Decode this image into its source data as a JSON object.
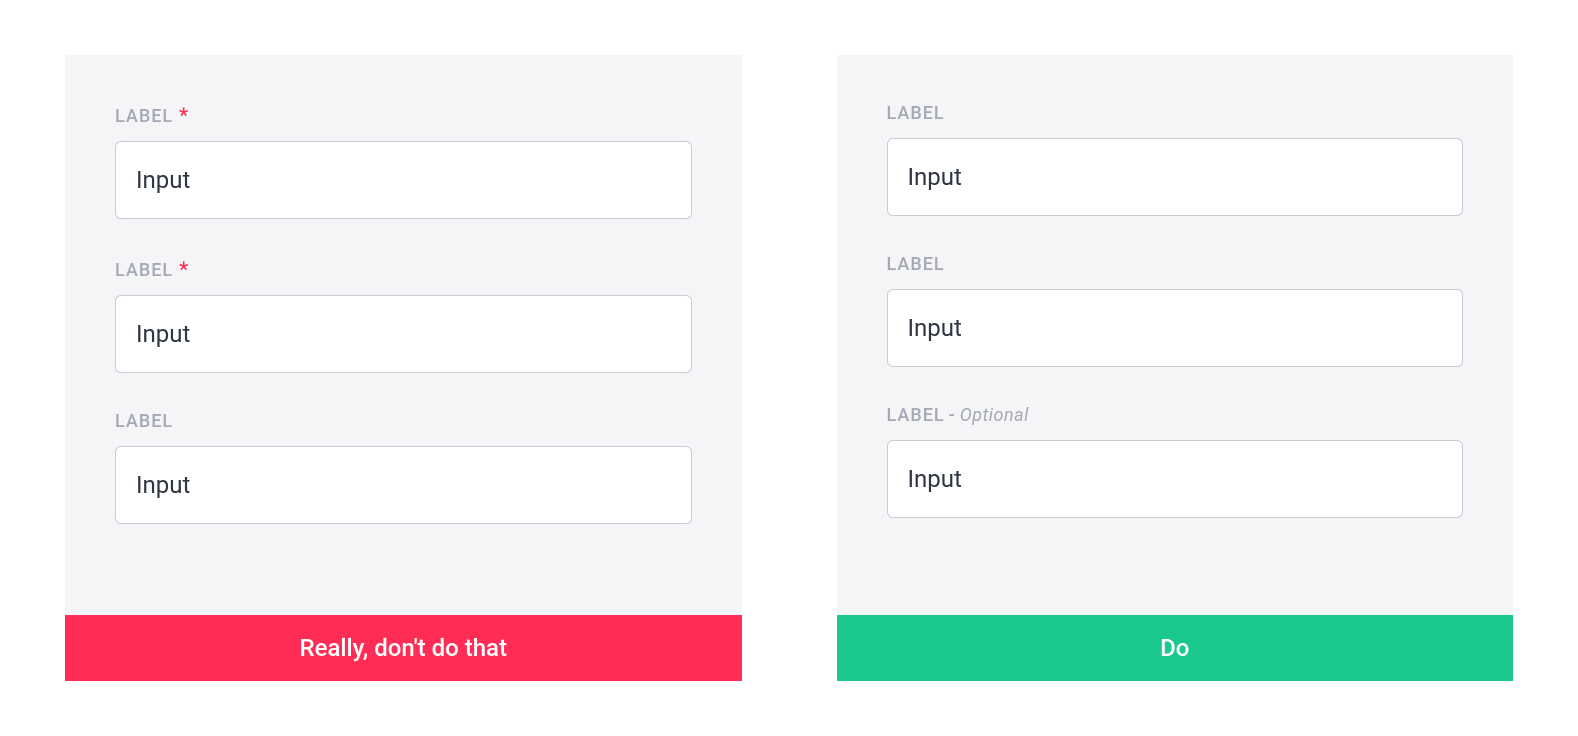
{
  "dont": {
    "fields": [
      {
        "label": "LABEL",
        "required": true,
        "value": "Input"
      },
      {
        "label": "LABEL",
        "required": true,
        "value": "Input"
      },
      {
        "label": "LABEL",
        "required": false,
        "value": "Input"
      }
    ],
    "required_marker": "*",
    "footer": "Really, don't do that"
  },
  "do": {
    "fields": [
      {
        "label": "LABEL",
        "optional": false,
        "value": "Input"
      },
      {
        "label": "LABEL",
        "optional": false,
        "value": "Input"
      },
      {
        "label": "LABEL",
        "optional": true,
        "value": "Input"
      }
    ],
    "optional_text": "Optional",
    "optional_separator": " - ",
    "footer": "Do"
  },
  "colors": {
    "dont": "#ff2d55",
    "do": "#1bc98e",
    "label": "#a3a9b5",
    "border": "#c9cdd6",
    "bg": "#f5f5f7"
  }
}
